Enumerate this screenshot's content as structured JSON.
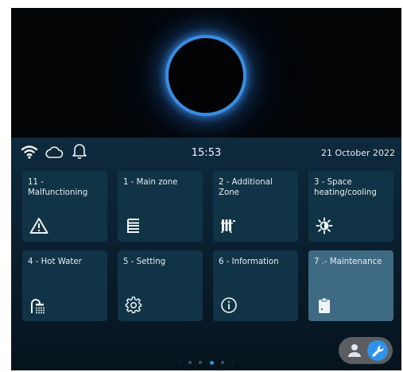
{
  "status": {
    "time": "15:53",
    "date": "21 October 2022",
    "icons": [
      "wifi-icon",
      "cloud-icon",
      "bell-icon"
    ]
  },
  "tiles": [
    {
      "label": "11 - Malfunctioning",
      "icon": "warning-icon"
    },
    {
      "label": "1 - Main zone",
      "icon": "main-zone-icon"
    },
    {
      "label": "2 - Additional\nZone",
      "icon": "radiator-icon"
    },
    {
      "label": "3 - Space\nheating/cooling",
      "icon": "heat-cool-icon"
    },
    {
      "label": "4 - Hot Water",
      "icon": "shower-icon"
    },
    {
      "label": "5 - Setting",
      "icon": "gear-icon"
    },
    {
      "label": "6 - Information",
      "icon": "info-icon"
    },
    {
      "label": "7 .- Maintenance",
      "icon": "clipboard-icon"
    }
  ],
  "pager": {
    "prev": "‹",
    "next": "›",
    "active_page": 3,
    "page_count": 5
  },
  "mode_toggle": {
    "options": [
      "user-icon",
      "wrench-icon"
    ],
    "selected": "wrench-icon"
  },
  "colors": {
    "accent": "#2e93e8",
    "glow": "#3a8de0",
    "tile": "#103346",
    "tile_active": "#3e6b83"
  }
}
